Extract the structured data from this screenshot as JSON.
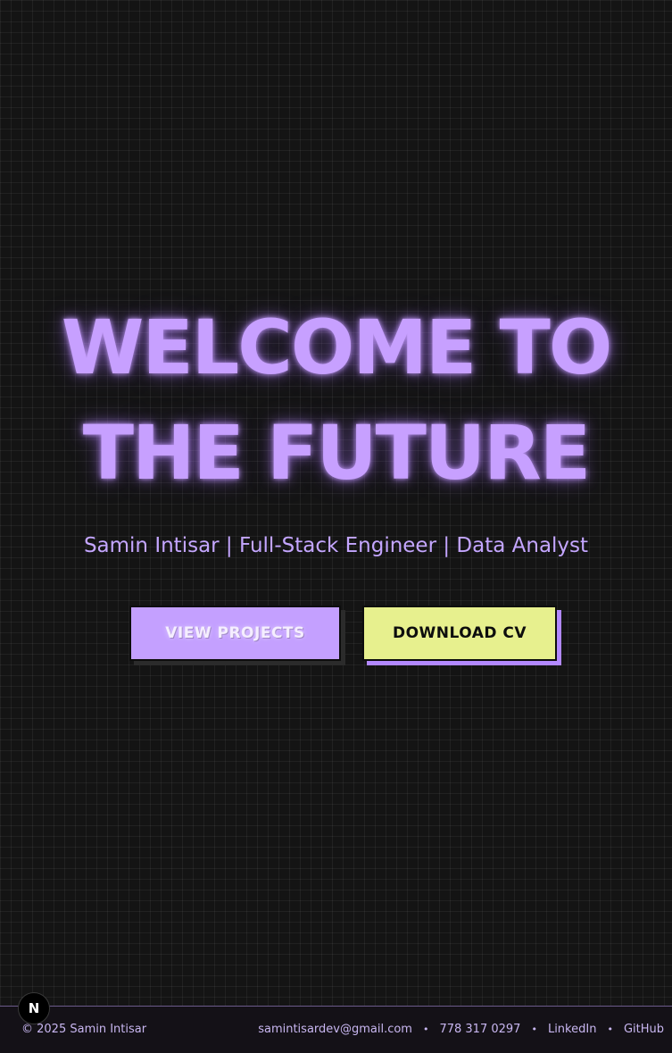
{
  "hero": {
    "title_line1": "WELCOME TO",
    "title_line2": "THE FUTURE",
    "subtitle": "Samin Intisar | Full-Stack Engineer | Data Analyst"
  },
  "actions": {
    "view_projects": "VIEW PROJECTS",
    "download_cv": "DOWNLOAD CV"
  },
  "badge": {
    "letter": "N"
  },
  "footer": {
    "copyright": "© 2025 Samin Intisar",
    "email": "samintisardev@gmail.com",
    "phone": "778 317 0297",
    "linkedin": "LinkedIn",
    "github": "GitHub",
    "separator": "•"
  },
  "colors": {
    "accent_purple": "#c4a0ff",
    "accent_lime": "#e7f08e",
    "background": "#141414"
  }
}
